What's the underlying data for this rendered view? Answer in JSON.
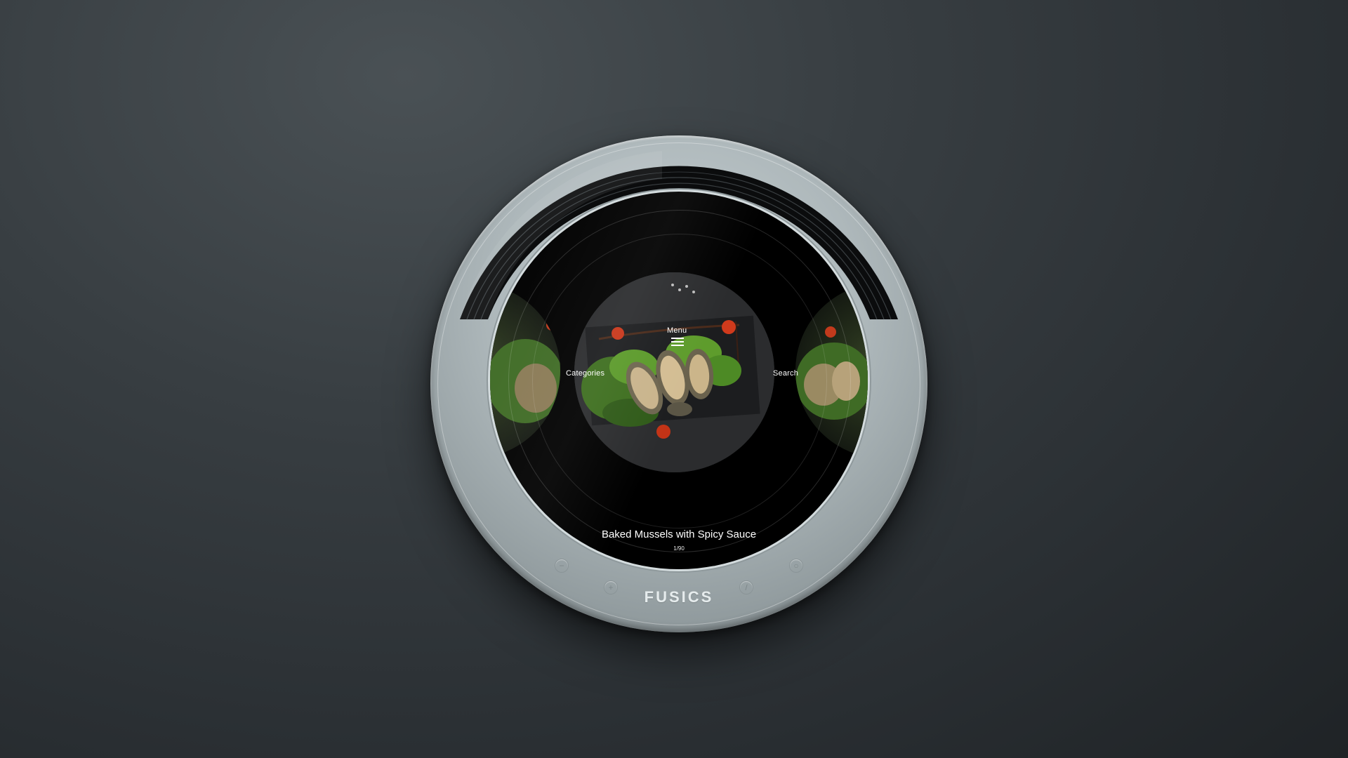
{
  "nav": {
    "menu_label": "Menu",
    "categories_label": "Categories",
    "search_label": "Search"
  },
  "dish": {
    "title": "Baked Mussels with Spicy Sauce",
    "counter": "1/90"
  },
  "hardware": {
    "brand": "FUSICS",
    "buttons": [
      "minus-icon",
      "plus-icon",
      "slash-icon",
      "power-icon"
    ]
  },
  "colors": {
    "background": "#2a2f33",
    "body_metal": "#aeb8bb",
    "screen": "#000000",
    "text": "#ffffff"
  }
}
